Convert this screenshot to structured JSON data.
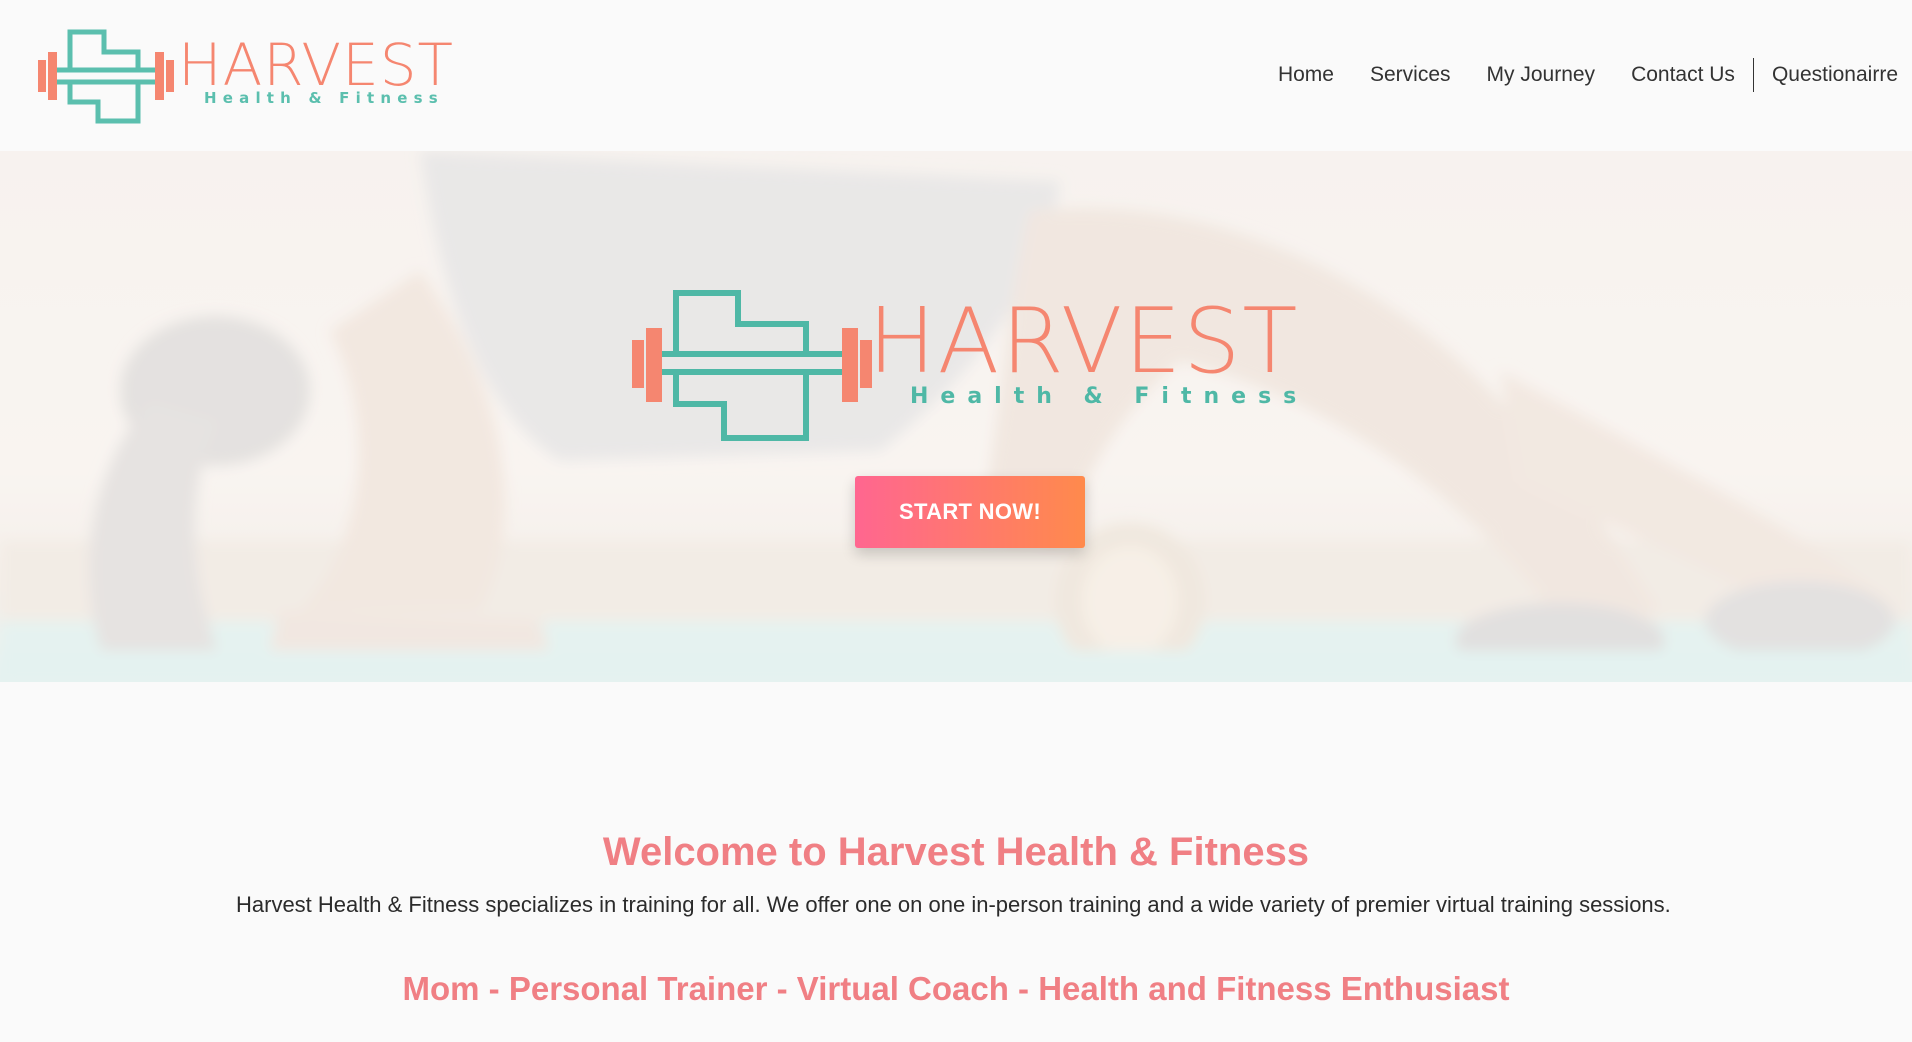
{
  "brand": {
    "name": "HARVEST",
    "tagline": "Health & Fitness",
    "colors": {
      "coral": "#f58670",
      "teal": "#5bbfae",
      "heading_pink": "#f07f84",
      "cta_start": "#ff6690",
      "cta_end": "#ff8a4c"
    }
  },
  "nav": {
    "items": [
      {
        "label": "Home"
      },
      {
        "label": "Services"
      },
      {
        "label": "My Journey"
      },
      {
        "label": "Contact Us"
      },
      {
        "label": "Questionairre"
      }
    ]
  },
  "hero": {
    "background": "blurred photo of woman exercising with foam roller",
    "cta_label": "START NOW!"
  },
  "main": {
    "welcome_heading": "Welcome to Harvest Health & Fitness",
    "intro_text": "Harvest Health & Fitness specializes in training for all. We offer one on one in-person training and a wide variety of premier virtual training sessions.",
    "roles": "Mom - Personal Trainer - Virtual Coach - Health and Fitness Enthusiast"
  },
  "icons": {
    "logo_mark": "dumbbell-h-icon"
  }
}
